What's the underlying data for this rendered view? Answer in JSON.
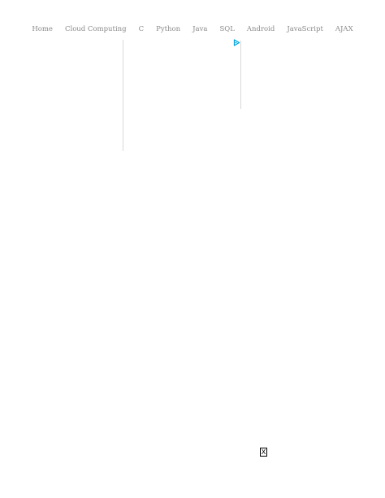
{
  "nav": {
    "items": [
      {
        "label": "Home"
      },
      {
        "label": "Cloud Computing"
      },
      {
        "label": "C"
      },
      {
        "label": "Python"
      },
      {
        "label": "Java"
      },
      {
        "label": "SQL"
      },
      {
        "label": "Android"
      },
      {
        "label": "JavaScript"
      },
      {
        "label": "AJAX"
      }
    ]
  },
  "ad": {
    "icon": "adchoices-play-icon",
    "accent": "#00a3d9"
  },
  "overlay": {
    "close_label": "X"
  }
}
